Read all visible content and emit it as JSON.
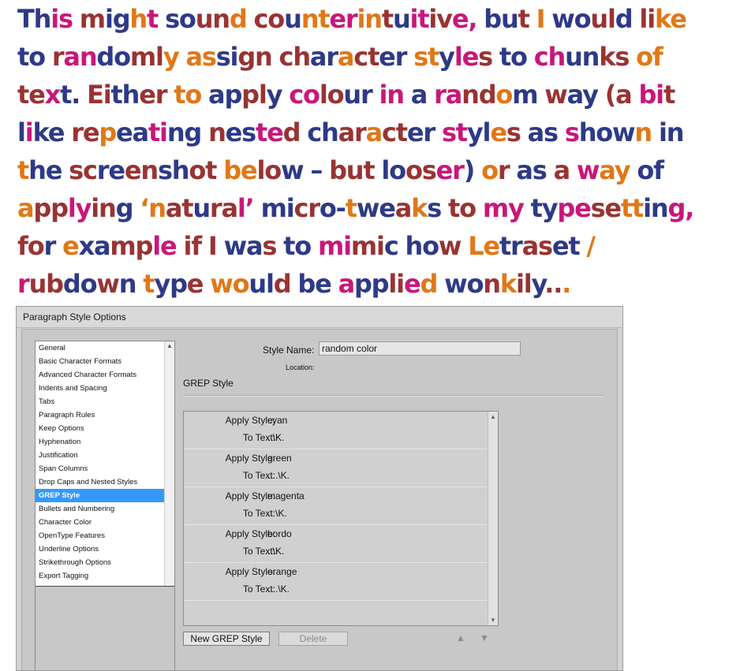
{
  "question": {
    "lines": [
      [
        [
          "Th",
          "#2e3a87"
        ],
        [
          "is ",
          "#c8177a"
        ],
        [
          "m",
          "#993333"
        ],
        [
          "ig",
          "#2e3a87"
        ],
        [
          "h",
          "#e07818"
        ],
        [
          "t ",
          "#c8177a"
        ],
        [
          "so",
          "#2e3a87"
        ],
        [
          "un",
          "#993333"
        ],
        [
          "d ",
          "#e07818"
        ],
        [
          "co",
          "#993333"
        ],
        [
          "u",
          "#2e3a87"
        ],
        [
          "nt",
          "#e07818"
        ],
        [
          "er",
          "#c8177a"
        ],
        [
          "in",
          "#e07818"
        ],
        [
          "t",
          "#993333"
        ],
        [
          "u",
          "#2e3a87"
        ],
        [
          "it",
          "#c8177a"
        ],
        [
          "iv",
          "#993333"
        ],
        [
          "e, ",
          "#c8177a"
        ],
        [
          "bu",
          "#2e3a87"
        ],
        [
          "t ",
          "#993333"
        ],
        [
          "I ",
          "#e07818"
        ],
        [
          "wo",
          "#2e3a87"
        ],
        [
          "ul",
          "#993333"
        ],
        [
          "d ",
          "#2e3a87"
        ],
        [
          "li",
          "#993333"
        ],
        [
          "ke",
          "#e07818"
        ]
      ],
      [
        [
          "to ",
          "#2e3a87"
        ],
        [
          "r",
          "#993333"
        ],
        [
          "an",
          "#c8177a"
        ],
        [
          "do",
          "#2e3a87"
        ],
        [
          "ml",
          "#993333"
        ],
        [
          "y ",
          "#e07818"
        ],
        [
          "as",
          "#e07818"
        ],
        [
          "si",
          "#2e3a87"
        ],
        [
          "gn ",
          "#993333"
        ],
        [
          "ch",
          "#993333"
        ],
        [
          "ar",
          "#2e3a87"
        ],
        [
          "a",
          "#e07818"
        ],
        [
          "ct",
          "#993333"
        ],
        [
          "er ",
          "#2e3a87"
        ],
        [
          "st",
          "#e07818"
        ],
        [
          "y",
          "#2e3a87"
        ],
        [
          "le",
          "#c8177a"
        ],
        [
          "s ",
          "#993333"
        ],
        [
          "to ",
          "#2e3a87"
        ],
        [
          "ch",
          "#c8177a"
        ],
        [
          "un",
          "#2e3a87"
        ],
        [
          "ks ",
          "#993333"
        ],
        [
          "of",
          "#e07818"
        ]
      ],
      [
        [
          "te",
          "#993333"
        ],
        [
          "x",
          "#c8177a"
        ],
        [
          "t. ",
          "#2e3a87"
        ],
        [
          "Ei",
          "#993333"
        ],
        [
          "th",
          "#2e3a87"
        ],
        [
          "er ",
          "#993333"
        ],
        [
          "to ",
          "#e07818"
        ],
        [
          "ap",
          "#2e3a87"
        ],
        [
          "pl",
          "#993333"
        ],
        [
          "y ",
          "#2e3a87"
        ],
        [
          "co",
          "#c8177a"
        ],
        [
          "lo",
          "#993333"
        ],
        [
          "ur ",
          "#2e3a87"
        ],
        [
          "in ",
          "#c8177a"
        ],
        [
          "a ",
          "#2e3a87"
        ],
        [
          "ra",
          "#c8177a"
        ],
        [
          "nd",
          "#993333"
        ],
        [
          "o",
          "#e07818"
        ],
        [
          "m ",
          "#2e3a87"
        ],
        [
          "w",
          "#993333"
        ],
        [
          "ay ",
          "#2e3a87"
        ],
        [
          "(a ",
          "#993333"
        ],
        [
          "bi",
          "#c8177a"
        ],
        [
          "t",
          "#993333"
        ]
      ],
      [
        [
          "l",
          "#2e3a87"
        ],
        [
          "i",
          "#c8177a"
        ],
        [
          "ke ",
          "#2e3a87"
        ],
        [
          "re",
          "#993333"
        ],
        [
          "p",
          "#e07818"
        ],
        [
          "ea",
          "#2e3a87"
        ],
        [
          "ti",
          "#c8177a"
        ],
        [
          "ng ",
          "#2e3a87"
        ],
        [
          "n",
          "#993333"
        ],
        [
          "es",
          "#2e3a87"
        ],
        [
          "te",
          "#c8177a"
        ],
        [
          "d ",
          "#993333"
        ],
        [
          "ch",
          "#2e3a87"
        ],
        [
          "ar",
          "#993333"
        ],
        [
          "a",
          "#e07818"
        ],
        [
          "ct",
          "#993333"
        ],
        [
          "er ",
          "#2e3a87"
        ],
        [
          "st",
          "#c8177a"
        ],
        [
          "yl",
          "#2e3a87"
        ],
        [
          "e",
          "#e07818"
        ],
        [
          "s ",
          "#993333"
        ],
        [
          "as ",
          "#2e3a87"
        ],
        [
          "s",
          "#c8177a"
        ],
        [
          "how",
          "#2e3a87"
        ],
        [
          "n ",
          "#e07818"
        ],
        [
          "in",
          "#2e3a87"
        ]
      ],
      [
        [
          "t",
          "#e07818"
        ],
        [
          "he ",
          "#2e3a87"
        ],
        [
          "sc",
          "#993333"
        ],
        [
          "re",
          "#2e3a87"
        ],
        [
          "en",
          "#993333"
        ],
        [
          "sh",
          "#2e3a87"
        ],
        [
          "ot ",
          "#993333"
        ],
        [
          "be",
          "#e07818"
        ],
        [
          "lo",
          "#993333"
        ],
        [
          "w ",
          "#2e3a87"
        ],
        [
          "– ",
          "#2e3a87"
        ],
        [
          "but ",
          "#993333"
        ],
        [
          "lo",
          "#2e3a87"
        ],
        [
          "os",
          "#993333"
        ],
        [
          "er",
          "#c8177a"
        ],
        [
          ") ",
          "#2e3a87"
        ],
        [
          "o",
          "#e07818"
        ],
        [
          "r ",
          "#993333"
        ],
        [
          "as ",
          "#2e3a87"
        ],
        [
          "a ",
          "#993333"
        ],
        [
          "w",
          "#c8177a"
        ],
        [
          "ay ",
          "#e07818"
        ],
        [
          "of",
          "#2e3a87"
        ]
      ],
      [
        [
          "a",
          "#e07818"
        ],
        [
          "pp",
          "#993333"
        ],
        [
          "ly",
          "#c8177a"
        ],
        [
          "in",
          "#993333"
        ],
        [
          "g ",
          "#2e3a87"
        ],
        [
          "‘n",
          "#e07818"
        ],
        [
          "at",
          "#993333"
        ],
        [
          "u",
          "#2e3a87"
        ],
        [
          "ra",
          "#993333"
        ],
        [
          "l’ ",
          "#c8177a"
        ],
        [
          "mi",
          "#2e3a87"
        ],
        [
          "cr",
          "#993333"
        ],
        [
          "o-",
          "#2e3a87"
        ],
        [
          "t",
          "#e07818"
        ],
        [
          "we",
          "#2e3a87"
        ],
        [
          "a",
          "#993333"
        ],
        [
          "k",
          "#e07818"
        ],
        [
          "s ",
          "#2e3a87"
        ],
        [
          "to ",
          "#993333"
        ],
        [
          "my ",
          "#c8177a"
        ],
        [
          "ty",
          "#2e3a87"
        ],
        [
          "pe",
          "#c8177a"
        ],
        [
          "se",
          "#993333"
        ],
        [
          "tt",
          "#e07818"
        ],
        [
          "in",
          "#2e3a87"
        ],
        [
          "g,",
          "#c8177a"
        ]
      ],
      [
        [
          "fo",
          "#993333"
        ],
        [
          "r ",
          "#2e3a87"
        ],
        [
          "e",
          "#e07818"
        ],
        [
          "xa",
          "#2e3a87"
        ],
        [
          "mp",
          "#993333"
        ],
        [
          "le ",
          "#c8177a"
        ],
        [
          "if ",
          "#993333"
        ],
        [
          "I ",
          "#993333"
        ],
        [
          "wa",
          "#2e3a87"
        ],
        [
          "s ",
          "#993333"
        ],
        [
          "to ",
          "#2e3a87"
        ],
        [
          "mi",
          "#c8177a"
        ],
        [
          "mi",
          "#993333"
        ],
        [
          "c ",
          "#2e3a87"
        ],
        [
          "ho",
          "#2e3a87"
        ],
        [
          "w ",
          "#993333"
        ],
        [
          "Le",
          "#e07818"
        ],
        [
          "tr",
          "#2e3a87"
        ],
        [
          "as",
          "#993333"
        ],
        [
          "et  ",
          "#2e3a87"
        ],
        [
          "/",
          "#e07818"
        ]
      ],
      [
        [
          "r",
          "#c8177a"
        ],
        [
          "ub",
          "#993333"
        ],
        [
          "do",
          "#2e3a87"
        ],
        [
          "w",
          "#993333"
        ],
        [
          "n ",
          "#2e3a87"
        ],
        [
          "t",
          "#e07818"
        ],
        [
          "yp",
          "#2e3a87"
        ],
        [
          "e ",
          "#993333"
        ],
        [
          "wo",
          "#e07818"
        ],
        [
          "ul",
          "#2e3a87"
        ],
        [
          "d ",
          "#993333"
        ],
        [
          "be ",
          "#2e3a87"
        ],
        [
          "a",
          "#c8177a"
        ],
        [
          "pp",
          "#2e3a87"
        ],
        [
          "li",
          "#993333"
        ],
        [
          "e",
          "#c8177a"
        ],
        [
          "d ",
          "#e07818"
        ],
        [
          "wo",
          "#2e3a87"
        ],
        [
          "n",
          "#993333"
        ],
        [
          "k",
          "#e07818"
        ],
        [
          "il",
          "#993333"
        ],
        [
          "y",
          "#2e3a87"
        ],
        [
          "..",
          "#993333"
        ],
        [
          ".",
          "#e07818"
        ]
      ]
    ]
  },
  "dialog": {
    "title": "Paragraph Style Options",
    "categories": [
      "General",
      "Basic Character Formats",
      "Advanced Character Formats",
      "Indents and Spacing",
      "Tabs",
      "Paragraph Rules",
      "Keep Options",
      "Hyphenation",
      "Justification",
      "Span Columns",
      "Drop Caps and Nested Styles",
      "GREP Style",
      "Bullets and Numbering",
      "Character Color",
      "OpenType Features",
      "Underline Options",
      "Strikethrough Options",
      "Export Tagging"
    ],
    "selected_category": "GREP Style",
    "style_name_label": "Style Name:",
    "style_name_value": "random color",
    "location_label": "Location:",
    "section_title": "GREP Style",
    "apply_style_label": "Apply Style:",
    "to_text_label": "To Text:",
    "grep_entries": [
      {
        "style": "cyan",
        "text": "..\\K."
      },
      {
        "style": "green",
        "text": "....\\K."
      },
      {
        "style": "magenta",
        "text": "...\\K."
      },
      {
        "style": "bordo",
        "text": "..\\K."
      },
      {
        "style": "orange",
        "text": "....\\K."
      }
    ],
    "new_button": "New GREP Style",
    "delete_button": "Delete",
    "move_up_icon": "triangle-up",
    "move_down_icon": "triangle-down"
  }
}
